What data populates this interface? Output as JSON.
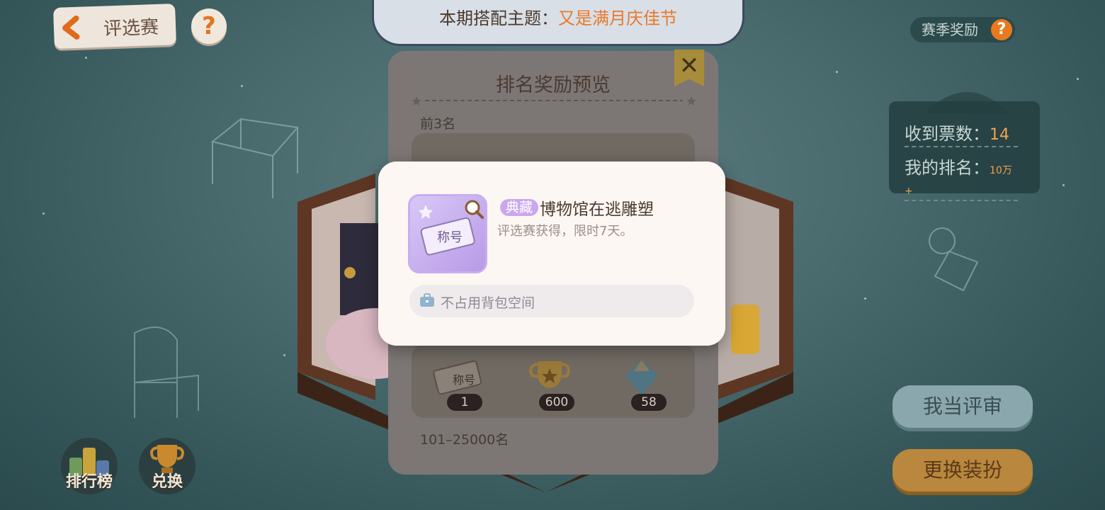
{
  "header": {
    "back_label": "评选赛",
    "help_symbol": "?",
    "theme_key": "本期搭配主题：",
    "theme_value": "又是满月庆佳节"
  },
  "season_reward": {
    "label": "赛季奖励",
    "help_symbol": "?"
  },
  "stats": {
    "votes_label": "收到票数：",
    "votes_value": "14",
    "rank_label": "我的排名：",
    "rank_value": "10万+"
  },
  "side_buttons": {
    "judge": "我当评审",
    "change_outfit": "更换装扮"
  },
  "bottom_nav": {
    "ranking": "排行榜",
    "exchange": "兑换"
  },
  "preview": {
    "title": "排名奖励预览",
    "close_symbol": "✕",
    "top_section": "前3名",
    "lower_section": "101–25000名",
    "lower_counts": [
      "1",
      "600",
      "58"
    ],
    "ticket_text": "称号"
  },
  "tooltip": {
    "rarity": "典藏",
    "name": "博物馆在逃雕塑",
    "description": "评选赛获得，限时7天。",
    "icon_text": "称号",
    "storage_note": "不占用背包空间"
  },
  "colors": {
    "accent_orange": "#e9792a",
    "rarity_purple": "#c9a8ee",
    "dialog_bg": "#fdf7f3"
  }
}
